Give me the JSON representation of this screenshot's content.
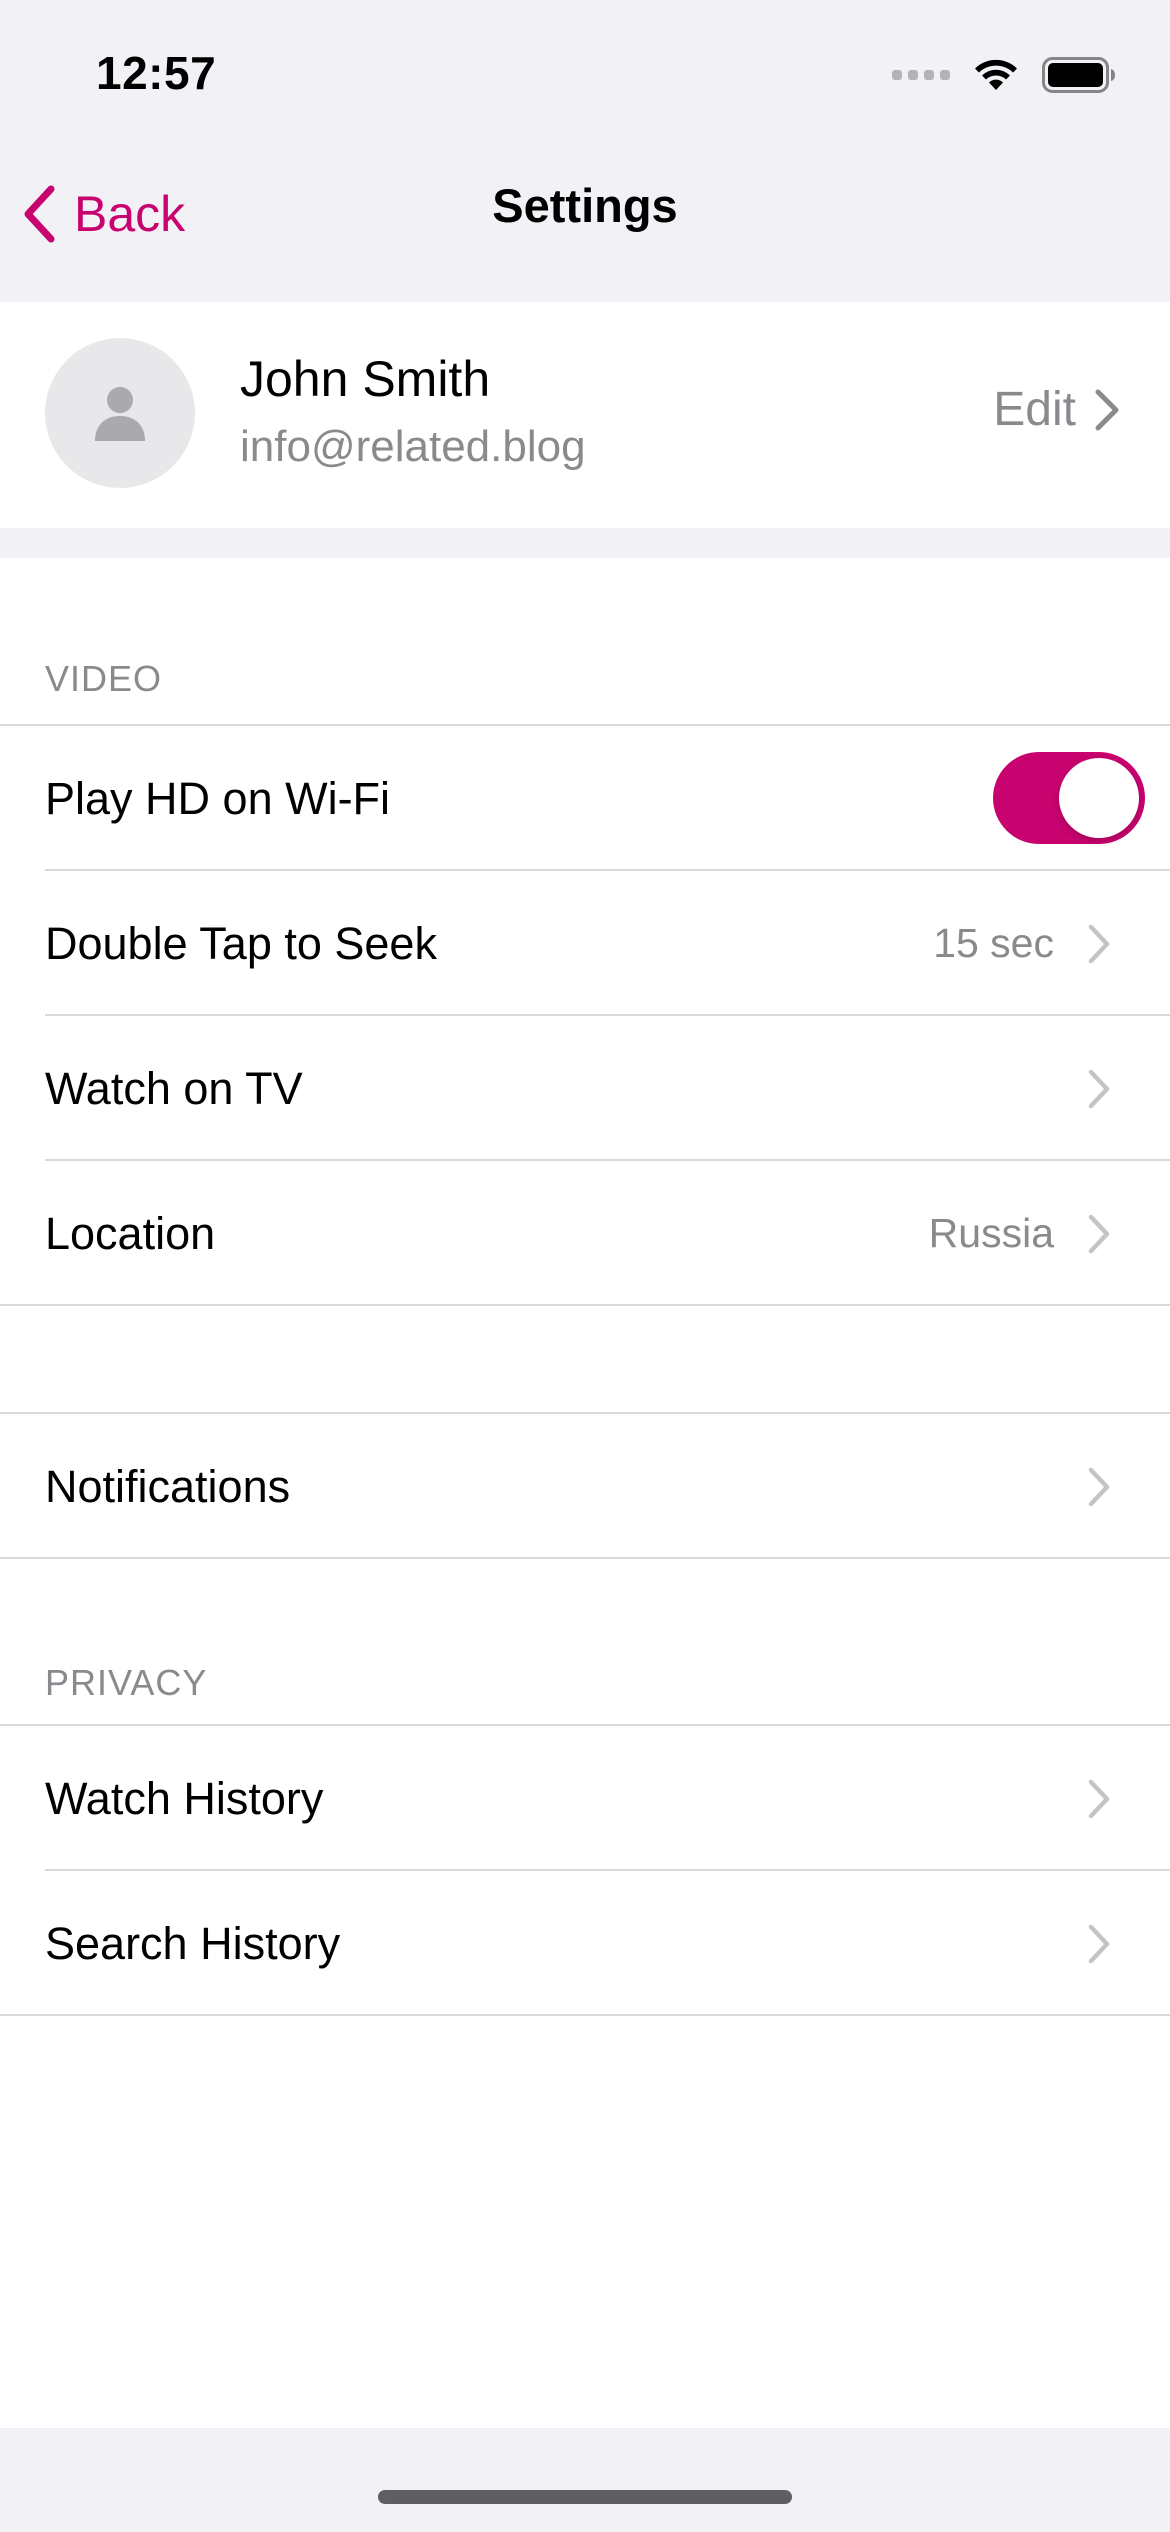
{
  "status_bar": {
    "time": "12:57"
  },
  "nav": {
    "back_label": "Back",
    "title": "Settings"
  },
  "profile": {
    "name": "John Smith",
    "email": "info@related.blog",
    "edit_label": "Edit"
  },
  "video_section": {
    "header": "VIDEO",
    "rows": [
      {
        "label": "Play HD on Wi-Fi",
        "toggle_on": true
      },
      {
        "label": "Double Tap to Seek",
        "value": "15 sec"
      },
      {
        "label": "Watch on TV",
        "value": ""
      },
      {
        "label": "Location",
        "value": "Russia"
      }
    ]
  },
  "notifications_section": {
    "rows": [
      {
        "label": "Notifications"
      }
    ]
  },
  "privacy_section": {
    "header": "PRIVACY",
    "rows": [
      {
        "label": "Watch History"
      },
      {
        "label": "Search History"
      }
    ]
  },
  "colors": {
    "accent": "#C8036F",
    "background": "#F2F1F6",
    "secondary_text": "#8A8A8E",
    "separator": "#D9D9DD"
  },
  "icons": {
    "back": "chevron-left-icon",
    "disclosure": "chevron-right-icon",
    "avatar": "person-icon",
    "wifi": "wifi-icon",
    "battery": "battery-icon",
    "cellular": "cellular-signal-icon"
  }
}
